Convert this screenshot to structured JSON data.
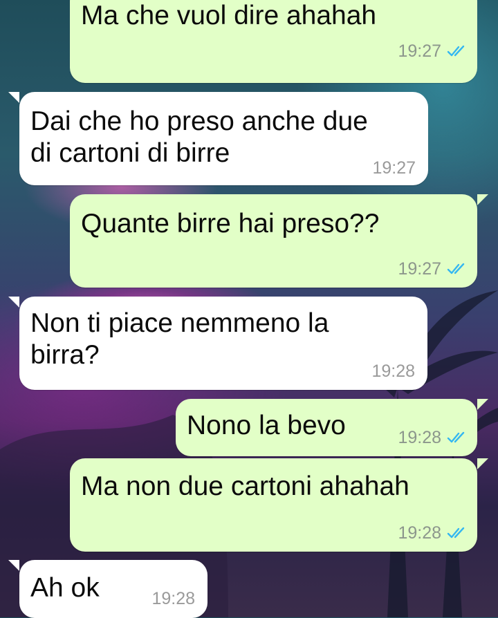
{
  "chat": {
    "messages": [
      {
        "direction": "outgoing",
        "text": "Ma che vuol dire ahahah",
        "time": "19:27",
        "status": "read-ticks"
      },
      {
        "direction": "incoming",
        "text": "Dai che ho preso anche due\ndi cartoni di birre",
        "time": "19:27"
      },
      {
        "direction": "outgoing",
        "text": "Quante birre hai preso??",
        "time": "19:27",
        "status": "read-ticks"
      },
      {
        "direction": "incoming",
        "text": "Non ti piace nemmeno la\nbirra?",
        "time": "19:28"
      },
      {
        "direction": "outgoing",
        "text": "Nono la bevo",
        "time": "19:28",
        "status": "read-ticks"
      },
      {
        "direction": "outgoing",
        "text": "Ma non due cartoni ahahah",
        "time": "19:28",
        "status": "read-ticks"
      },
      {
        "direction": "incoming",
        "text": "Ah ok",
        "time": "19:28"
      }
    ]
  },
  "colors": {
    "outgoing_bubble": "#e2ffc7",
    "incoming_bubble": "#ffffff",
    "read_ticks": "#34b7f1"
  }
}
